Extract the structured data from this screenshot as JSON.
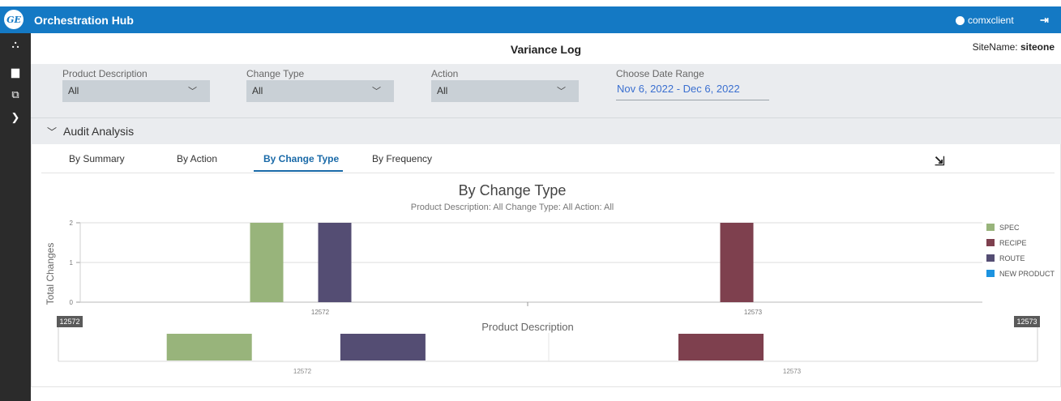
{
  "header": {
    "logo_text": "GE",
    "app_title": "Orchestration Hub",
    "user_name": "comxclient"
  },
  "sidebar": {
    "items": [
      {
        "icon": "sitemap-icon",
        "glyph": "⛬"
      },
      {
        "icon": "factory-icon",
        "glyph": "▆"
      },
      {
        "icon": "clone-icon",
        "glyph": "⧉"
      },
      {
        "icon": "chevron-right-icon",
        "glyph": "❯"
      }
    ]
  },
  "page": {
    "title": "Variance Log",
    "site_label": "SiteName:",
    "site_value": "siteone"
  },
  "filters": {
    "product": {
      "label": "Product Description",
      "value": "All"
    },
    "change_type": {
      "label": "Change Type",
      "value": "All"
    },
    "action": {
      "label": "Action",
      "value": "All"
    },
    "date_range": {
      "label": "Choose Date Range",
      "value": "Nov 6, 2022 - Dec 6, 2022"
    }
  },
  "accordion": {
    "title": "Audit Analysis"
  },
  "tabs": [
    {
      "label": "By Summary",
      "active": false
    },
    {
      "label": "By Action",
      "active": false
    },
    {
      "label": "By Change Type",
      "active": true
    },
    {
      "label": "By Frequency",
      "active": false
    }
  ],
  "colors": {
    "header": "#1479c4",
    "spec": "#98b47b",
    "recipe": "#7e404e",
    "route": "#544d73",
    "new_product": "#1c93e0",
    "active_tab": "#1a6aa8"
  },
  "chart_data": {
    "type": "bar",
    "title": "By Change Type",
    "subtitle": "Product Description: All   Change Type: All   Action: All",
    "xlabel": "Product Description",
    "ylabel": "Total Changes",
    "ylim": [
      0,
      2
    ],
    "yticks": [
      "0",
      "1",
      "2"
    ],
    "categories": [
      "12572",
      "12573"
    ],
    "series": [
      {
        "name": "SPEC",
        "values": [
          2,
          0
        ]
      },
      {
        "name": "RECIPE",
        "values": [
          0,
          2
        ]
      },
      {
        "name": "ROUTE",
        "values": [
          2,
          0
        ]
      },
      {
        "name": "NEW PRODUCT",
        "values": [
          0,
          0
        ]
      }
    ],
    "legend_position": "right",
    "navigator": {
      "start_label": "12572",
      "end_label": "12573"
    }
  }
}
